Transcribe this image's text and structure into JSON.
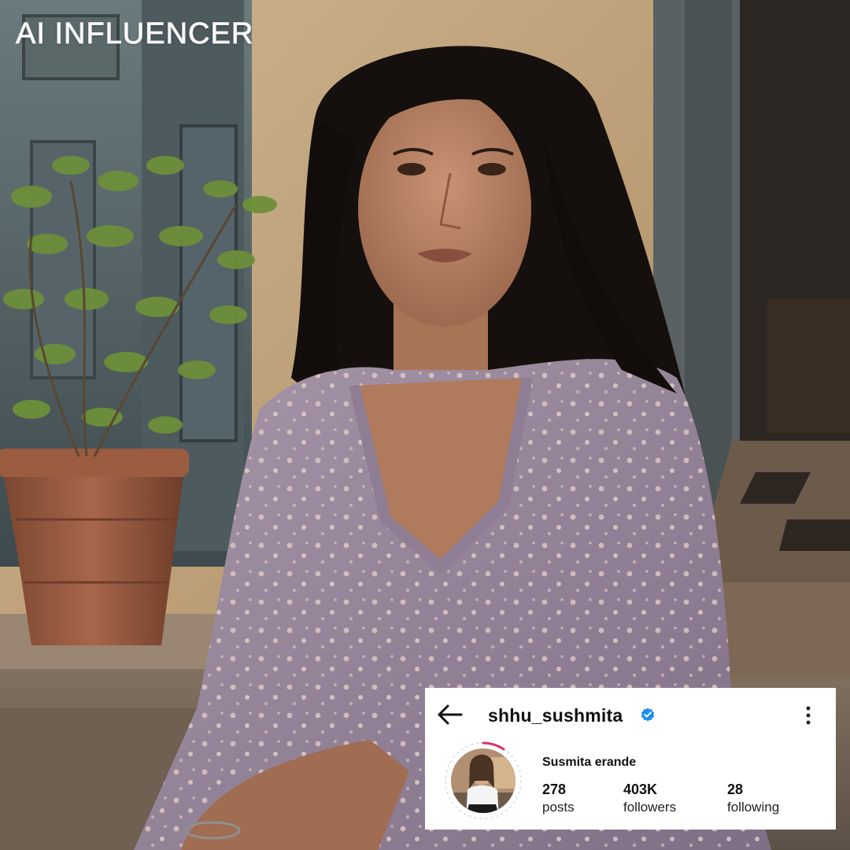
{
  "overlay": {
    "title": "AI INFLUENCER"
  },
  "profile": {
    "username": "shhu_sushmita",
    "verified": true,
    "display_name": "Susmita erande",
    "stats": [
      {
        "value": "278",
        "label": "posts"
      },
      {
        "value": "403K",
        "label": "followers"
      },
      {
        "value": "28",
        "label": "following"
      }
    ],
    "icons": {
      "back": "arrow-left-icon",
      "verified": "verified-badge-icon",
      "more": "more-vertical-icon"
    }
  },
  "colors": {
    "verified_blue": "#1f8ef1",
    "story_ring_pink": "#e0306a",
    "card_bg": "#ffffff"
  }
}
